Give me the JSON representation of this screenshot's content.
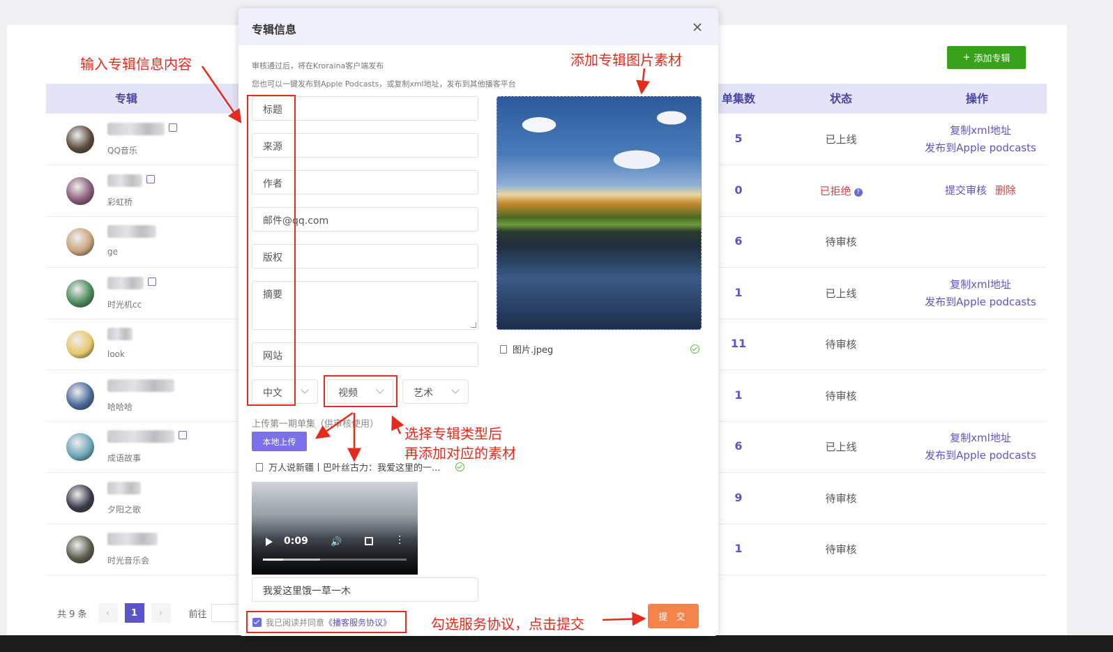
{
  "background": {
    "add_button": "添加专辑",
    "columns": [
      "专辑",
      "单集数",
      "状态",
      "操作"
    ],
    "rows": [
      {
        "sub": "QQ音乐",
        "count": "5",
        "status": "已上线",
        "ops": [
          "复制xml地址",
          "发布到Apple podcasts"
        ],
        "avatar_color": "#5a4a3a",
        "blur_w": 82,
        "edit": true
      },
      {
        "sub": "彩虹桥",
        "count": "0",
        "status": "已拒绝",
        "status_type": "rejected",
        "ops": [
          "提交审核",
          "删除"
        ],
        "avatar_color": "#8a5a78",
        "blur_w": 50,
        "edit": true
      },
      {
        "sub": "ge",
        "count": "6",
        "status": "待审核",
        "ops": [],
        "avatar_color": "#c9a37a",
        "blur_w": 70,
        "edit": false
      },
      {
        "sub": "时光机cc",
        "count": "1",
        "status": "已上线",
        "ops": [
          "复制xml地址",
          "发布到Apple podcasts"
        ],
        "avatar_color": "#4a8a5a",
        "blur_w": 52,
        "edit": true
      },
      {
        "sub": "look",
        "count": "11",
        "status": "待审核",
        "ops": [],
        "avatar_color": "#e8c86a",
        "blur_w": 36,
        "edit": false
      },
      {
        "sub": "哈哈哈",
        "count": "1",
        "status": "待审核",
        "ops": [],
        "avatar_color": "#4a6a9a",
        "blur_w": 96,
        "edit": false
      },
      {
        "sub": "成语故事",
        "count": "6",
        "status": "已上线",
        "ops": [
          "复制xml地址",
          "发布到Apple podcasts"
        ],
        "avatar_color": "#6aa6b8",
        "blur_w": 96,
        "edit": true
      },
      {
        "sub": "夕阳之歌",
        "count": "9",
        "status": "待审核",
        "ops": [],
        "avatar_color": "#3a3a4a",
        "blur_w": 48,
        "edit": false
      },
      {
        "sub": "时光音乐会",
        "count": "1",
        "status": "待审核",
        "ops": [],
        "avatar_color": "#5a5a4a",
        "blur_w": 72,
        "edit": false
      }
    ],
    "pagination": {
      "total": "共 9 条",
      "current": "1",
      "goto": "前往"
    }
  },
  "dialog": {
    "title": "专辑信息",
    "note1": "审核通过后，将在Kroraina客户端发布",
    "note2": "您也可以一键发布到Apple Podcasts，或复制xml地址，发布到其他播客平台",
    "fields": {
      "title": "标题",
      "source": "来源",
      "author": "作者",
      "email": "邮件@qq.com",
      "copyright": "版权",
      "summary": "摘要",
      "website": "网站"
    },
    "selects": {
      "language": "中文",
      "type": "视频",
      "category": "艺术"
    },
    "upload_label": "上传第一期单集（供审核使用）",
    "local_upload": "本地上传",
    "episode_file": "万人说新疆丨巴叶丝古力：我爱这里的一...",
    "video": {
      "time": "0:09",
      "progress": 0.14,
      "buffered": 0.4
    },
    "episode_title": "我爱这里饿一草一木",
    "image_file": "图片.jpeg",
    "agree_text": "我已阅读并同意",
    "agree_link": "《播客服务协议》",
    "submit": "提 交"
  },
  "annotations": {
    "input_info": "输入专辑信息内容",
    "add_image": "添加专辑图片素材",
    "select_type_1": "选择专辑类型后",
    "select_type_2": "再添加对应的素材",
    "agree_submit": "勾选服务协议，点击提交"
  }
}
